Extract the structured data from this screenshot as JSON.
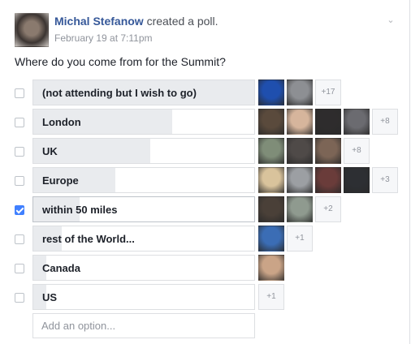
{
  "post": {
    "author": "Michal Stefanow",
    "action": " created a poll.",
    "timestamp": "February 19 at 7:11pm"
  },
  "poll": {
    "question": "Where do you come from for the Summit?",
    "options": [
      {
        "label": "(not attending but I wish to go)",
        "checked": false,
        "vote_share": 1.0,
        "voters": [
          {
            "name": "voter-avatar-blue",
            "color": "#1f4fae"
          },
          {
            "name": "voter-avatar-man",
            "color": "#8d8f93"
          }
        ],
        "more": "+17"
      },
      {
        "label": "London",
        "checked": false,
        "vote_share": 0.63,
        "voters": [
          {
            "name": "voter-avatar-1",
            "color": "#5a4a3c"
          },
          {
            "name": "voter-avatar-2",
            "color": "#d6b59c"
          },
          {
            "name": "voter-avatar-3",
            "color": "#2e2c2d"
          },
          {
            "name": "voter-avatar-4",
            "color": "#6b6b70"
          }
        ],
        "more": "+8"
      },
      {
        "label": "UK",
        "checked": false,
        "vote_share": 0.53,
        "voters": [
          {
            "name": "voter-avatar-5",
            "color": "#7f8d78"
          },
          {
            "name": "voter-avatar-6",
            "color": "#4f4a48"
          },
          {
            "name": "voter-avatar-7",
            "color": "#7c6556"
          }
        ],
        "more": "+8"
      },
      {
        "label": "Europe",
        "checked": false,
        "vote_share": 0.37,
        "voters": [
          {
            "name": "voter-avatar-8",
            "color": "#d9c39c"
          },
          {
            "name": "voter-avatar-9",
            "color": "#9c9fa3"
          },
          {
            "name": "voter-avatar-10",
            "color": "#6a3c3a"
          },
          {
            "name": "voter-avatar-11",
            "color": "#2d2f33"
          }
        ],
        "more": "+3"
      },
      {
        "label": "within 50 miles",
        "checked": true,
        "vote_share": 0.21,
        "voters": [
          {
            "name": "voter-avatar-self",
            "color": "#4a4038"
          },
          {
            "name": "voter-avatar-12",
            "color": "#8f9a8f"
          }
        ],
        "more": "+2"
      },
      {
        "label": "rest of the World...",
        "checked": false,
        "vote_share": 0.13,
        "voters": [
          {
            "name": "voter-avatar-13",
            "color": "#3b6db5"
          }
        ],
        "more": "+1"
      },
      {
        "label": "Canada",
        "checked": false,
        "vote_share": 0.06,
        "voters": [
          {
            "name": "voter-avatar-14",
            "color": "#caa487"
          }
        ],
        "more": ""
      },
      {
        "label": "US",
        "checked": false,
        "vote_share": 0.06,
        "voters": [],
        "more": "+1"
      }
    ],
    "add_option_placeholder": "Add an option..."
  },
  "icons": {
    "chevron": "chevron-down-icon"
  }
}
